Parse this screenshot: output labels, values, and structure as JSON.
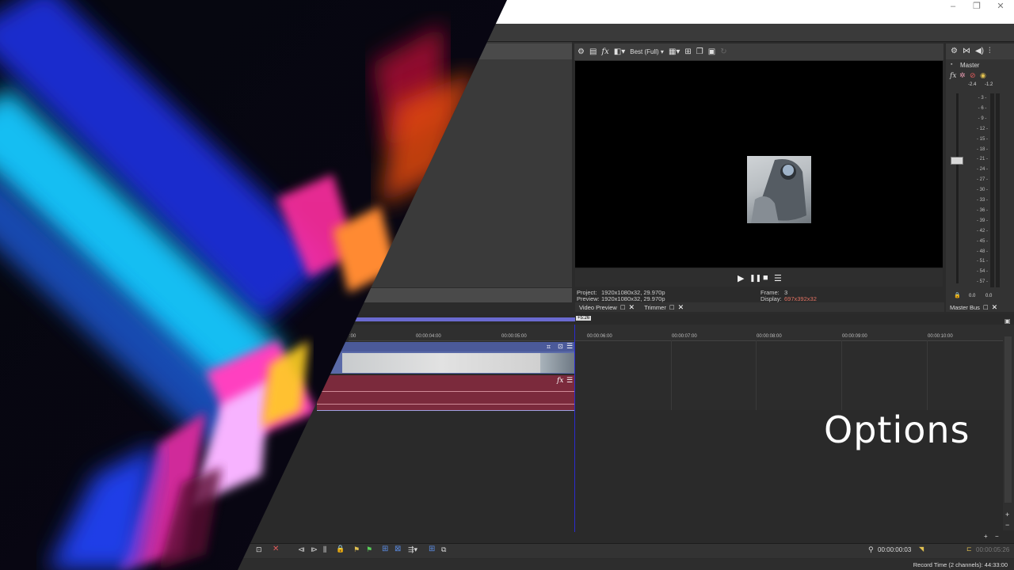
{
  "window": {
    "minimize": "–",
    "maximize": "❐",
    "close": "✕"
  },
  "preview": {
    "quality": "Best (Full)",
    "transport": {
      "play": "▶",
      "pause": "❚❚",
      "stop": "■",
      "menu": "☰"
    },
    "project_label": "Project:",
    "project_value": "1920x1080x32, 29.970p",
    "preview_label": "Preview:",
    "preview_value": "1920x1080x32, 29.970p",
    "frame_label": "Frame:",
    "frame_value": "3",
    "display_label": "Display:",
    "display_value": "697x392x32",
    "tabs": [
      {
        "label": "Video Preview"
      },
      {
        "label": "Trimmer"
      }
    ]
  },
  "master": {
    "title": "Master",
    "peak_left": "-2.4",
    "peak_right": "-1.2",
    "scale": [
      "3",
      "6",
      "9",
      "12",
      "15",
      "18",
      "21",
      "24",
      "27",
      "30",
      "33",
      "36",
      "39",
      "42",
      "45",
      "48",
      "51",
      "54",
      "57"
    ],
    "level_left": "0.0",
    "level_right": "0.0",
    "tab": "Master Bus"
  },
  "timeline": {
    "cursor_label": "+5:26",
    "ticks_left": [
      "00:00:04:00",
      "00:00:05:00"
    ],
    "ticks_right": [
      "00:00:06:00",
      "00:00:07:00",
      "00:00:08:00",
      "00:00:09:00",
      "00:00:10:00"
    ],
    "left_tick_partial": ":00"
  },
  "bottom": {
    "cursor_time": "00:00:00:03",
    "end_time": "00:00:05:26",
    "record_time": "Record Time (2 channels): 44:33:00"
  },
  "caption": {
    "text": "Options"
  },
  "colors": {
    "accent": "#2b2bd0",
    "video_track": "#5a6aa8",
    "audio_track": "#7b2a3c",
    "display_value": "#e07060"
  },
  "icons": [
    "gear-icon",
    "fx-icon",
    "grid-icon",
    "save-icon",
    "play-icon",
    "pause-icon",
    "stop-icon",
    "menu-icon",
    "lock-icon",
    "close-icon"
  ]
}
